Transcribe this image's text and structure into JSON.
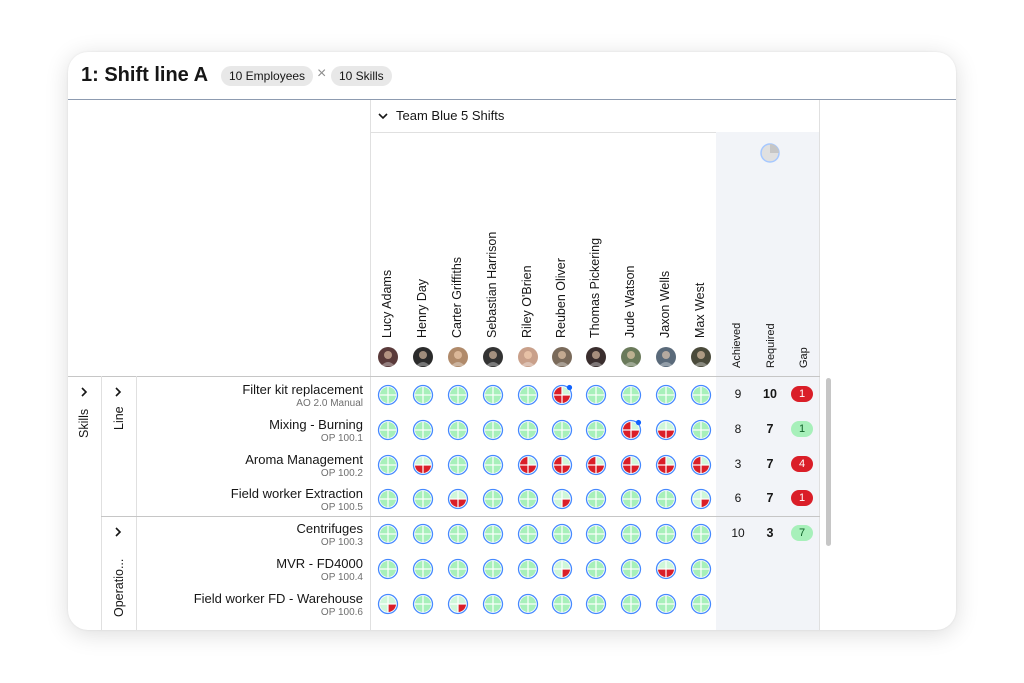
{
  "header": {
    "title": "1: Shift line A",
    "employees_chip": "10 Employees",
    "times_sign": "×",
    "skills_chip": "10 Skills"
  },
  "team": {
    "label": "Team Blue 5 Shifts",
    "toggle_icon": "chevron-down-icon"
  },
  "employees": [
    {
      "name": "Lucy Adams",
      "avatar_color": "#5a3a3a"
    },
    {
      "name": "Henry Day",
      "avatar_color": "#2b2b2b"
    },
    {
      "name": "Carter Griffiths",
      "avatar_color": "#b08a6a"
    },
    {
      "name": "Sebastian Harrison",
      "avatar_color": "#333333"
    },
    {
      "name": "Riley O'Brien",
      "avatar_color": "#c9a08a"
    },
    {
      "name": "Reuben Oliver",
      "avatar_color": "#7a6a5a"
    },
    {
      "name": "Thomas Pickering",
      "avatar_color": "#3a2e2e"
    },
    {
      "name": "Jude Watson",
      "avatar_color": "#6a7a5a"
    },
    {
      "name": "Jaxon Wells",
      "avatar_color": "#5a6a7a"
    },
    {
      "name": "Max West",
      "avatar_color": "#4a4a3a"
    }
  ],
  "summary_headers": {
    "achieved": "Achieved",
    "required": "Required",
    "gap": "Gap"
  },
  "summary_icon": "progress-pie-icon",
  "axis": {
    "skills_label": "Skills"
  },
  "groups": [
    {
      "label": "Line",
      "expand_icon": "chevron-right-icon",
      "achieved": "",
      "required": "",
      "gap": ""
    },
    {
      "label": "Operatio...",
      "expand_icon": "chevron-right-icon"
    }
  ],
  "skills": [
    {
      "name": "Filter kit replacement",
      "code": "AO 2.0 Manual",
      "group": 0,
      "achieved": "9",
      "required": "10",
      "gap": "1",
      "gap_status": "red",
      "levels": [
        2,
        2,
        2,
        2,
        2,
        "r3d",
        2,
        2,
        2,
        2
      ]
    },
    {
      "name": "Mixing - Burning",
      "code": "OP 100.1",
      "group": 0,
      "achieved": "8",
      "required": "7",
      "gap": "1",
      "gap_status": "green",
      "levels": [
        2,
        2,
        2,
        2,
        2,
        2,
        2,
        "r3d",
        "r2",
        2
      ]
    },
    {
      "name": "Aroma Management",
      "code": "OP 100.2",
      "group": 0,
      "achieved": "3",
      "required": "7",
      "gap": "4",
      "gap_status": "red",
      "levels": [
        3,
        "r2",
        2,
        2,
        "r3",
        "r3",
        "r3",
        "r3",
        "r3",
        "r3"
      ]
    },
    {
      "name": "Field worker Extraction",
      "code": "OP 100.5",
      "group": 0,
      "achieved": "6",
      "required": "7",
      "gap": "1",
      "gap_status": "red",
      "levels": [
        2,
        2,
        "r2",
        2,
        2,
        "r1",
        2,
        2,
        2,
        "r1"
      ]
    },
    {
      "name": "Centrifuges",
      "code": "OP 100.3",
      "group": 1,
      "achieved": "10",
      "required": "3",
      "gap": "7",
      "gap_status": "green",
      "levels": [
        2,
        2,
        2,
        2,
        2,
        2,
        2,
        2,
        2,
        2
      ]
    },
    {
      "name": "MVR - FD4000",
      "code": "OP 100.4",
      "group": 1,
      "achieved": "",
      "required": "",
      "gap": "",
      "gap_status": "",
      "levels": [
        2,
        2,
        2,
        2,
        3,
        "r1",
        2,
        2,
        "r2",
        2
      ]
    },
    {
      "name": "Field worker FD - Warehouse",
      "code": "OP 100.6",
      "group": 1,
      "achieved": "",
      "required": "",
      "gap": "",
      "gap_status": "",
      "levels": [
        "r1",
        2,
        "r1",
        2,
        3,
        2,
        2,
        2,
        2,
        2
      ]
    }
  ],
  "colors": {
    "green_fill": "#a7f0ba",
    "red_fill": "#da1e28",
    "ring": "#4589ff",
    "marker": "#0f62fe"
  }
}
